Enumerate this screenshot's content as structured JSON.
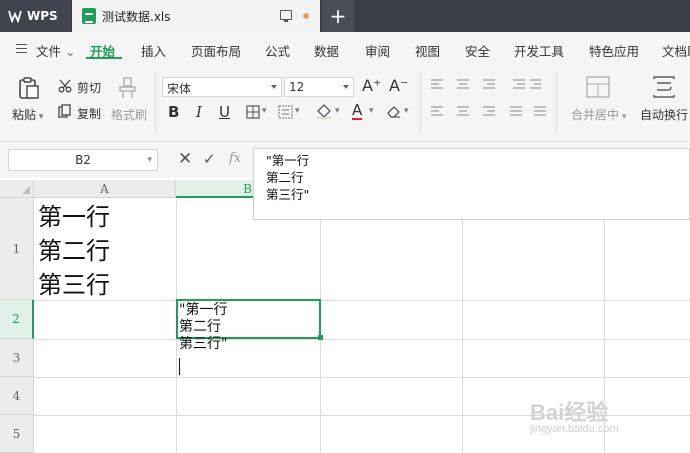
{
  "titlebar": {
    "app_name": "WPS",
    "document_title": "测试数据.xls",
    "new_tab_symbol": "+"
  },
  "menu": {
    "file_label": "文件",
    "items": [
      "开始",
      "插入",
      "页面布局",
      "公式",
      "数据",
      "审阅",
      "视图",
      "安全",
      "开发工具",
      "特色应用",
      "文档助"
    ],
    "active_item": "开始"
  },
  "ribbon": {
    "paste_label": "粘贴",
    "cut_label": "剪切",
    "copy_label": "复制",
    "format_painter_label": "格式刷",
    "font_name": "宋体",
    "font_size": "12",
    "bold": "B",
    "italic": "I",
    "underline": "U",
    "grow_font": "A⁺",
    "shrink_font": "A⁻",
    "font_color": "A",
    "merge_center_label": "合并居中",
    "wrap_text_label": "自动换行"
  },
  "formula_bar": {
    "cell_reference": "B2",
    "cancel_symbol": "✕",
    "confirm_symbol": "✓",
    "fx_label": "fx",
    "content_lines": [
      "\"第一行",
      "第二行",
      "第三行\""
    ]
  },
  "grid": {
    "columns": [
      "A",
      "B"
    ],
    "rows": [
      "1",
      "2",
      "3",
      "4",
      "5"
    ],
    "selected_cell": "B2",
    "cells": {
      "A1": [
        "第一行",
        "第二行",
        "第三行"
      ],
      "B2": [
        "\"第一行",
        "第二行",
        "第三行\""
      ]
    }
  },
  "watermark": {
    "brand": "Bai经验",
    "url": "jingyan.baidu.com"
  },
  "colors": {
    "accent": "#1f9e5a",
    "titlebar": "#3a3f47"
  }
}
